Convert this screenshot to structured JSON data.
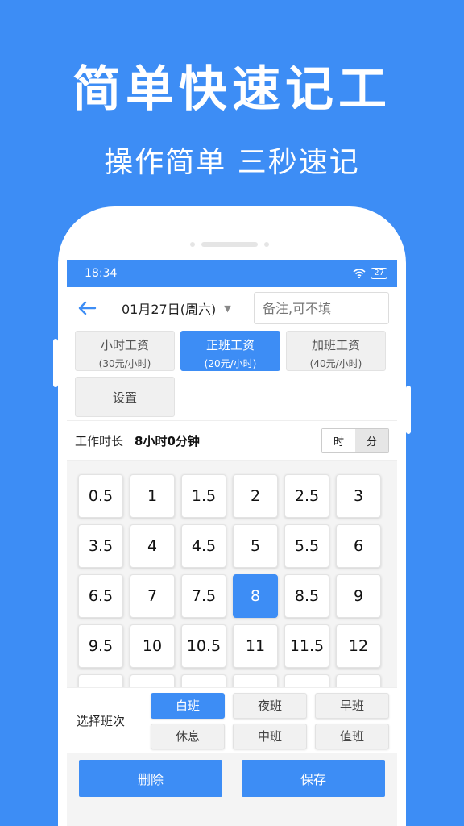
{
  "promo": {
    "headline": "简单快速记工",
    "subline": "操作简单 三秒速记"
  },
  "status": {
    "time": "18:34",
    "battery": "27"
  },
  "topbar": {
    "date": "01月27日(周六)",
    "note_placeholder": "备注,可不填"
  },
  "wages": [
    {
      "title": "小时工资",
      "sub": "(30元/小时)",
      "active": false
    },
    {
      "title": "正班工资",
      "sub": "(20元/小时)",
      "active": true
    },
    {
      "title": "加班工资",
      "sub": "(40元/小时)",
      "active": false
    }
  ],
  "settings_label": "设置",
  "duration": {
    "label": "工作时长",
    "value": "8小时0分钟",
    "unit_hour": "时",
    "unit_min": "分"
  },
  "hours": [
    "0.5",
    "1",
    "1.5",
    "2",
    "2.5",
    "3",
    "3.5",
    "4",
    "4.5",
    "5",
    "5.5",
    "6",
    "6.5",
    "7",
    "7.5",
    "8",
    "8.5",
    "9",
    "9.5",
    "10",
    "10.5",
    "11",
    "11.5",
    "12",
    "",
    "",
    "",
    "",
    "",
    ""
  ],
  "selected_hour": "8",
  "shift": {
    "label": "选择班次",
    "options": [
      "白班",
      "夜班",
      "早班",
      "休息",
      "中班",
      "值班"
    ],
    "selected": "白班"
  },
  "actions": {
    "delete": "删除",
    "save": "保存"
  },
  "colors": {
    "accent": "#3d8df5"
  }
}
